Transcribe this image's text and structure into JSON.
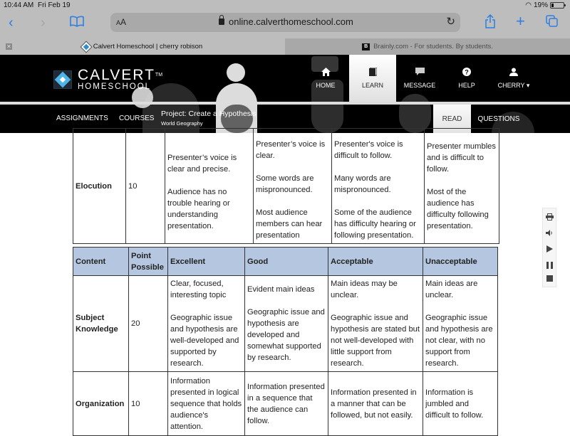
{
  "status_bar": {
    "time": "10:44 AM",
    "date": "Fri Feb 19",
    "battery": "19%"
  },
  "browser": {
    "text_size_label": "AA",
    "url": "online.calverthomeschool.com",
    "tabs": [
      {
        "title": "Calvert Homeschool | cherry robison",
        "active": true
      },
      {
        "title": "Brainly.com - For students. By students.",
        "active": false
      }
    ],
    "icons": {
      "back": "chevron-left-icon",
      "forward": "chevron-right-icon",
      "bookmarks": "book-icon",
      "reload": "reload-icon",
      "share": "share-icon",
      "new_tab": "plus-icon",
      "tabs": "tabs-icon"
    }
  },
  "site": {
    "logo": {
      "line1": "CALVERT",
      "tm": "TM",
      "line2": "HOMESCHOOL"
    },
    "top_nav": [
      {
        "label": "HOME",
        "icon": "home-icon",
        "active": false
      },
      {
        "label": "LEARN",
        "icon": "book-icon",
        "active": true
      },
      {
        "label": "MESSAGE",
        "icon": "message-icon",
        "active": false
      },
      {
        "label": "HELP",
        "icon": "help-icon",
        "active": false
      },
      {
        "label": "CHERRY ▾",
        "icon": "user-icon",
        "active": false
      }
    ],
    "sub_nav": {
      "assignments": "ASSIGNMENTS",
      "courses": "COURSES",
      "project_title": "Project: Create a Hypothesis",
      "project_subject": "World Geography",
      "read": "READ",
      "questions": "QUESTIONS"
    }
  },
  "rubric_top": {
    "row": {
      "criterion": "Elocution",
      "points": "10",
      "excellent": [
        "Presenter’s voice is clear and precise.",
        "Audience has no trouble hearing or understanding presentation."
      ],
      "good": [
        "Presenter’s voice is clear.",
        "Some words are mispronounced.",
        "Most audience members can hear presentation"
      ],
      "acceptable": [
        "Presenter's voice is difficult to follow.",
        "Many words are mispronounced.",
        "Some of the audience has difficulty hearing or following presentation."
      ],
      "unacceptable": [
        "Presenter mumbles and is difficult to follow.",
        "Most of the audience has difficulty following presentation."
      ]
    }
  },
  "rubric_content": {
    "headers": [
      "Content",
      "Point Possible",
      "Excellent",
      "Good",
      "Acceptable",
      "Unacceptable"
    ],
    "rows": [
      {
        "criterion": "Subject Knowledge",
        "points": "20",
        "excellent": [
          "Clear, focused, interesting topic",
          "Geographic issue and hypothesis are well-developed and supported by research."
        ],
        "good": [
          "Evident main ideas",
          "Geographic issue and hypothesis are developed and somewhat supported by research."
        ],
        "acceptable": [
          "Main ideas may be unclear.",
          "Geographic issue and hypothesis are stated but not well-developed with little support from research."
        ],
        "unacceptable": [
          "Main ideas are unclear.",
          "Geographic issue and hypothesis are not clear, with no support from research."
        ]
      },
      {
        "criterion": "Organization",
        "points": "10",
        "excellent": [
          "Information presented in logical sequence that holds audience's attention."
        ],
        "good": [
          "Information presented in a sequence that the audience can follow."
        ],
        "acceptable": [
          "Information presented in a manner that can be followed, but not easily."
        ],
        "unacceptable": [
          "Information is jumbled and difficult to follow."
        ]
      }
    ]
  },
  "side_tools": [
    {
      "name": "print",
      "icon": "printer-icon"
    },
    {
      "name": "speak",
      "icon": "speaker-icon"
    },
    {
      "name": "play",
      "icon": "play-icon"
    },
    {
      "name": "pause",
      "icon": "pause-icon"
    },
    {
      "name": "stop",
      "icon": "stop-icon"
    }
  ],
  "colors": {
    "header_bg": "#000000",
    "table_header_bg": "#b5c7e0",
    "ios_accent": "#2f7fe0",
    "logo_accent": "#4fb5e6"
  }
}
